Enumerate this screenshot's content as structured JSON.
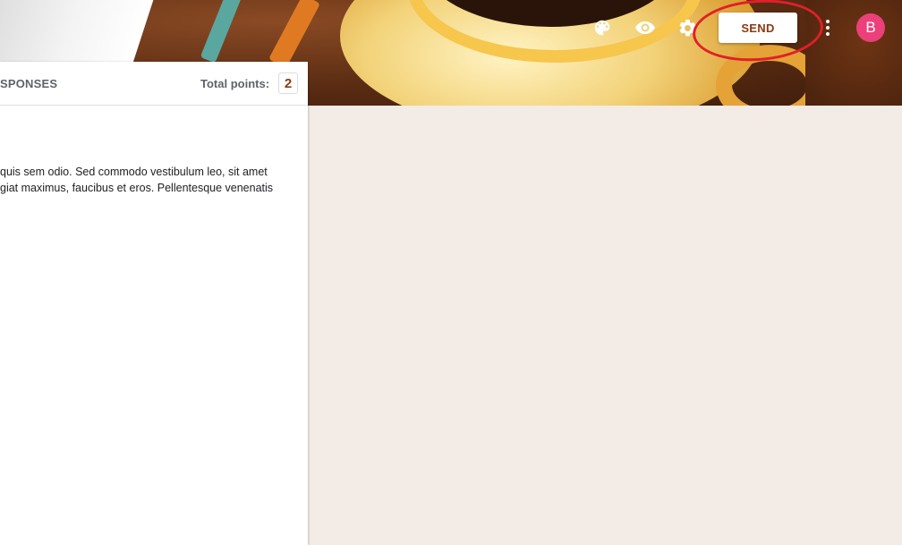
{
  "header": {
    "send_label": "SEND",
    "avatar_letter": "B"
  },
  "card": {
    "tab_label": "SPONSES",
    "total_points_label": "Total points:",
    "total_points_value": "2",
    "description_line1": "quis sem odio. Sed commodo vestibulum leo, sit amet",
    "description_line2": "giat maximus, faucibus et eros. Pellentesque venenatis"
  },
  "colors": {
    "accent": "#8a3b12",
    "avatar_bg": "#ec407a",
    "page_bg": "#f3ebe6",
    "highlight": "#e0202a"
  },
  "icons": [
    "palette-icon",
    "eye-icon",
    "gear-icon",
    "more-vert-icon"
  ]
}
